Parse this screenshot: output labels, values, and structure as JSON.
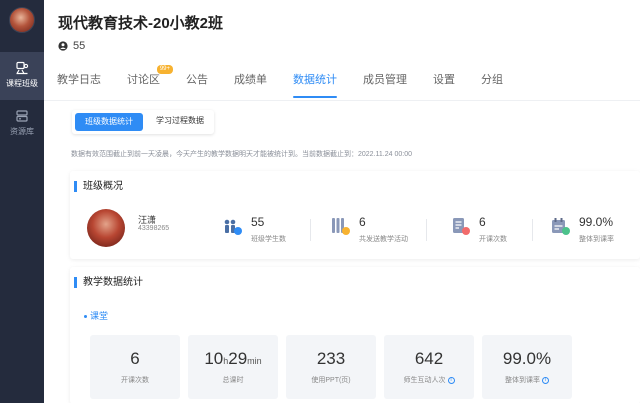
{
  "sidebar": {
    "items": [
      {
        "label": "课程班级",
        "icon": "class-icon",
        "active": true
      },
      {
        "label": "资源库",
        "icon": "library-icon",
        "active": false
      }
    ]
  },
  "header": {
    "title": "现代教育技术-20小教2班",
    "member_count": "55",
    "member_icon": "user-icon"
  },
  "tabs": [
    {
      "label": "教学日志",
      "active": false
    },
    {
      "label": "讨论区",
      "active": false,
      "badge": "99+"
    },
    {
      "label": "公告",
      "active": false
    },
    {
      "label": "成绩单",
      "active": false
    },
    {
      "label": "数据统计",
      "active": true
    },
    {
      "label": "成员管理",
      "active": false
    },
    {
      "label": "设置",
      "active": false
    },
    {
      "label": "分组",
      "active": false
    }
  ],
  "subtabs": [
    {
      "label": "班级数据统计",
      "active": true
    },
    {
      "label": "学习过程数据",
      "active": false
    }
  ],
  "notice": "数据有效范围截止到前一天凌晨，今天产生的教学数据明天才能被统计到。当前数据截止到：2022.11.24 00:00",
  "overview": {
    "title": "班级概况",
    "teacher": {
      "name": "汪潇",
      "id": "43398265"
    },
    "stats": [
      {
        "value": "55",
        "label": "班级学生数",
        "icon": "students-icon",
        "color": "#2f8cf5"
      },
      {
        "value": "6",
        "label": "共发送教学活动",
        "icon": "activity-icon",
        "color": "#f7b230"
      },
      {
        "value": "6",
        "label": "开课次数",
        "icon": "lesson-icon",
        "color": "#f26b6b"
      },
      {
        "value": "99.0%",
        "label": "整体到课率",
        "icon": "attendance-icon",
        "color": "#4cc28b"
      }
    ]
  },
  "teaching": {
    "title": "教学数据统计",
    "section": "课堂",
    "boxes": [
      {
        "value": "6",
        "label": "开课次数",
        "info": false
      },
      {
        "value_h": "10",
        "unit_h": "h",
        "value_m": "29",
        "unit_m": "min",
        "label": "总课时",
        "info": false
      },
      {
        "value": "233",
        "label": "使用PPT(页)",
        "info": false
      },
      {
        "value": "642",
        "label": "师生互动人次",
        "info": true
      },
      {
        "value": "99.0%",
        "label": "整体到课率",
        "info": true
      }
    ]
  }
}
